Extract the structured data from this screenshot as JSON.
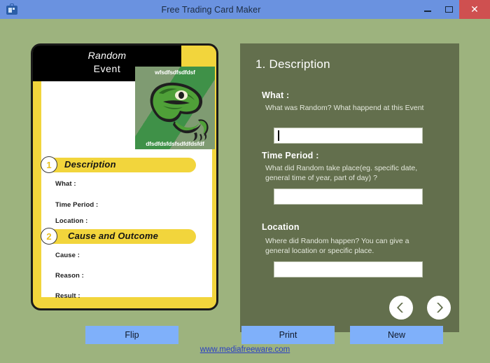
{
  "window": {
    "title": "Free Trading Card Maker",
    "app_icon": "card-maker-icon",
    "minimize_label": "–",
    "maximize_label": "□",
    "close_label": "✕"
  },
  "card": {
    "title_line1": "Random",
    "title_line2": "Event",
    "image": {
      "caption_top": "wfsdfsdfsdfdsf",
      "caption_bottom": "dfsdfdsfdsfsdfdfdsfdf",
      "alt": "philosoraptor-meme-image"
    },
    "sections": [
      {
        "number": "1",
        "label": "Description",
        "fields": [
          "What :",
          "Time Period :",
          "Location :"
        ]
      },
      {
        "number": "2",
        "label": "Cause and Outcome",
        "fields": [
          "Cause :",
          "Reason :",
          "Result :"
        ]
      }
    ]
  },
  "panel": {
    "heading": "1. Description",
    "groups": [
      {
        "label": "What :",
        "help": "What was Random? What happend at this Event",
        "value": "",
        "placeholder": ""
      },
      {
        "label": "Time Period :",
        "help": "What did Random take place(eg. specific date, general time of year, part of day) ?",
        "value": "",
        "placeholder": ""
      },
      {
        "label": "Location",
        "help": "Where did Random happen? You can give a general location or specific place.",
        "value": "",
        "placeholder": ""
      }
    ],
    "nav": {
      "prev_icon": "chevron-left-icon",
      "next_icon": "chevron-right-icon"
    }
  },
  "buttons": {
    "flip": "Flip",
    "print": "Print",
    "new": "New"
  },
  "footer": {
    "link": "www.mediafreeware.com"
  },
  "colors": {
    "titlebar": "#6a92e0",
    "close_button": "#cf5050",
    "background": "#9db37e",
    "panel": "#636f4d",
    "card_yellow": "#f2d53c",
    "button_blue": "#7fb0fa",
    "link": "#2a3fc4"
  }
}
